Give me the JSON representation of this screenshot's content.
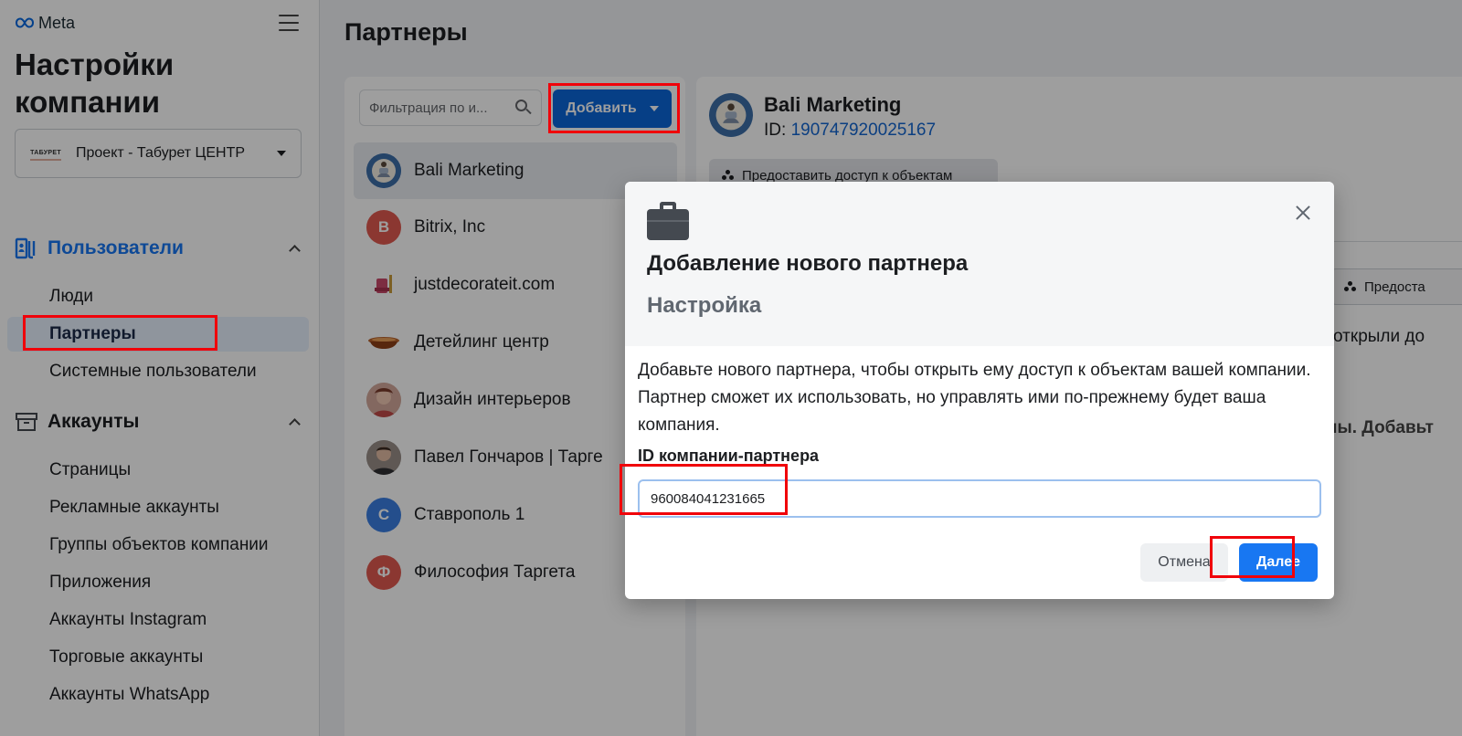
{
  "brand": {
    "logo_text": "Meta"
  },
  "sidebar": {
    "title": "Настройки компании",
    "business": {
      "logo_text": "ТАБУРЕТ",
      "name": "Проект - Табурет ЦЕНТР"
    },
    "sections": [
      {
        "label": "Пользователи",
        "icon": "users-icon",
        "items": [
          {
            "label": "Люди"
          },
          {
            "label": "Партнеры"
          },
          {
            "label": "Системные пользователи"
          }
        ]
      },
      {
        "label": "Аккаунты",
        "icon": "archive-box-icon",
        "items": [
          {
            "label": "Страницы"
          },
          {
            "label": "Рекламные аккаунты"
          },
          {
            "label": "Группы объектов компании"
          },
          {
            "label": "Приложения"
          },
          {
            "label": "Аккаунты Instagram"
          },
          {
            "label": "Торговые аккаунты"
          },
          {
            "label": "Аккаунты WhatsApp"
          }
        ]
      }
    ]
  },
  "main": {
    "title": "Партнеры",
    "search": {
      "placeholder": "Фильтрация по и..."
    },
    "add_button": "Добавить",
    "partners": [
      {
        "name": "Bali Marketing",
        "avatar": "meditation-logo",
        "initial": ""
      },
      {
        "name": "Bitrix, Inc",
        "avatar": "letter",
        "initial": "B",
        "color": "#e05a4f"
      },
      {
        "name": "justdecorateit.com",
        "avatar": "chair-logo",
        "initial": ""
      },
      {
        "name": "Детейлинг центр",
        "avatar": "bowl-logo",
        "initial": ""
      },
      {
        "name": "Дизайн интерьеров",
        "avatar": "photo",
        "initial": ""
      },
      {
        "name": "Павел Гончаров | Тарге",
        "avatar": "photo",
        "initial": ""
      },
      {
        "name": "Ставрополь 1",
        "avatar": "letter",
        "initial": "С",
        "color": "#3b7fe3"
      },
      {
        "name": "Философия Таргета",
        "avatar": "letter",
        "initial": "Ф",
        "color": "#e05a4f"
      }
    ]
  },
  "detail": {
    "name": "Bali Marketing",
    "id_prefix": "ID: ",
    "id": "190747920025167",
    "grant_access": "Предоставить доступ к объектам",
    "grant_access_short": "Предоста",
    "text_1": "вы открыли до",
    "text_2": "нены. Добавьт"
  },
  "modal": {
    "title": "Добавление нового партнера",
    "step": "Настройка",
    "description": "Добавьте нового партнера, чтобы открыть ему доступ к объектам вашей компании. Партнер сможет их использовать, но управлять ими по-прежнему будет ваша компания.",
    "field_label": "ID компании-партнера",
    "field_value": "960084041231665",
    "cancel": "Отмена",
    "next": "Далее"
  },
  "colors": {
    "accent": "#1877f2",
    "highlight": "#f0020a",
    "add_button": "#0a66d8"
  }
}
